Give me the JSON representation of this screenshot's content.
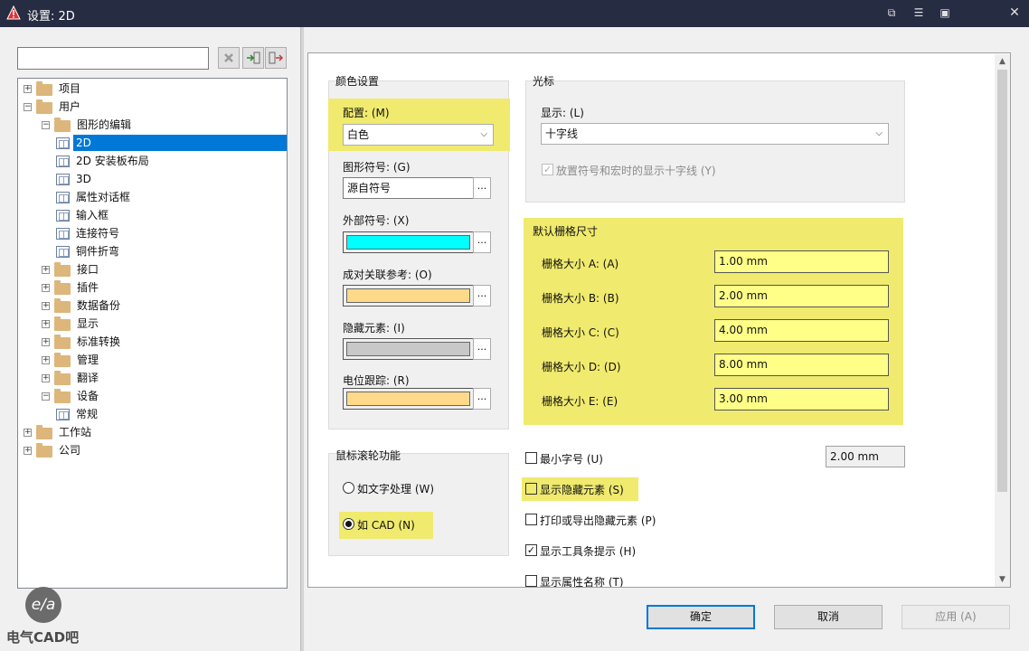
{
  "window": {
    "title": "设置: 2D"
  },
  "tree": [
    {
      "label": "项目",
      "level": 0,
      "type": "folder",
      "exp": "+"
    },
    {
      "label": "用户",
      "level": 0,
      "type": "folder",
      "exp": "−"
    },
    {
      "label": "图形的编辑",
      "level": 1,
      "type": "folder",
      "exp": "−"
    },
    {
      "label": "2D",
      "level": 2,
      "type": "page",
      "selected": true
    },
    {
      "label": "2D 安装板布局",
      "level": 2,
      "type": "page"
    },
    {
      "label": "3D",
      "level": 2,
      "type": "page"
    },
    {
      "label": "属性对话框",
      "level": 2,
      "type": "page"
    },
    {
      "label": "输入框",
      "level": 2,
      "type": "page"
    },
    {
      "label": "连接符号",
      "level": 2,
      "type": "page"
    },
    {
      "label": "铜件折弯",
      "level": 2,
      "type": "page"
    },
    {
      "label": "接口",
      "level": 1,
      "type": "folder",
      "exp": "+"
    },
    {
      "label": "插件",
      "level": 1,
      "type": "folder",
      "exp": "+"
    },
    {
      "label": "数据备份",
      "level": 1,
      "type": "folder",
      "exp": "+"
    },
    {
      "label": "显示",
      "level": 1,
      "type": "folder",
      "exp": "+"
    },
    {
      "label": "标准转换",
      "level": 1,
      "type": "folder",
      "exp": "+"
    },
    {
      "label": "管理",
      "level": 1,
      "type": "folder",
      "exp": "+"
    },
    {
      "label": "翻译",
      "level": 1,
      "type": "folder",
      "exp": "+"
    },
    {
      "label": "设备",
      "level": 1,
      "type": "folder",
      "exp": "−"
    },
    {
      "label": "常规",
      "level": 2,
      "type": "page"
    },
    {
      "label": "工作站",
      "level": 0,
      "type": "folder",
      "exp": "+"
    },
    {
      "label": "公司",
      "level": 0,
      "type": "folder",
      "exp": "+"
    }
  ],
  "color": {
    "group_label": "颜色设置",
    "scheme_label": "配置: (M)",
    "scheme_value": "白色",
    "symbol_label": "图形符号: (G)",
    "symbol_value": "源自符号",
    "external_label": "外部符号: (X)",
    "pair_label": "成对关联参考: (O)",
    "hidden_label": "隐藏元素: (I)",
    "potential_label": "电位跟踪: (R)",
    "dots": "...",
    "colors": {
      "external": "#00ffff",
      "pair": "#ffd98a",
      "hidden": "#c8c8c8",
      "potential": "#ffd98a",
      "highlight": "#f0ea6e"
    }
  },
  "cursor": {
    "group_label": "光标",
    "display_label": "显示: (L)",
    "display_value": "十字线",
    "crosshair_check": "放置符号和宏时的显示十字线 (Y)"
  },
  "grid": {
    "group_label": "默认栅格尺寸",
    "rows": [
      {
        "label": "栅格大小 A: (A)",
        "value": "1.00 mm"
      },
      {
        "label": "栅格大小 B: (B)",
        "value": "2.00 mm"
      },
      {
        "label": "栅格大小 C: (C)",
        "value": "4.00 mm"
      },
      {
        "label": "栅格大小 D: (D)",
        "value": "8.00 mm"
      },
      {
        "label": "栅格大小 E: (E)",
        "value": "3.00 mm"
      }
    ]
  },
  "wheel": {
    "group_label": "鼠标滚轮功能",
    "opt1": "如文字处理 (W)",
    "opt2": "如 CAD  (N)"
  },
  "checks": {
    "min_font": "最小字号 (U)",
    "min_font_value": "2.00 mm",
    "show_hidden": "显示隐藏元素 (S)",
    "print_hidden": "打印或导出隐藏元素 (P)",
    "toolbar_tips": "显示工具条提示 (H)",
    "prop_names": "显示属性名称 (T)"
  },
  "buttons": {
    "ok": "确定",
    "cancel": "取消",
    "apply": "应用 (A)"
  },
  "watermark": {
    "logo": "e/a",
    "text": "电气CAD吧"
  }
}
